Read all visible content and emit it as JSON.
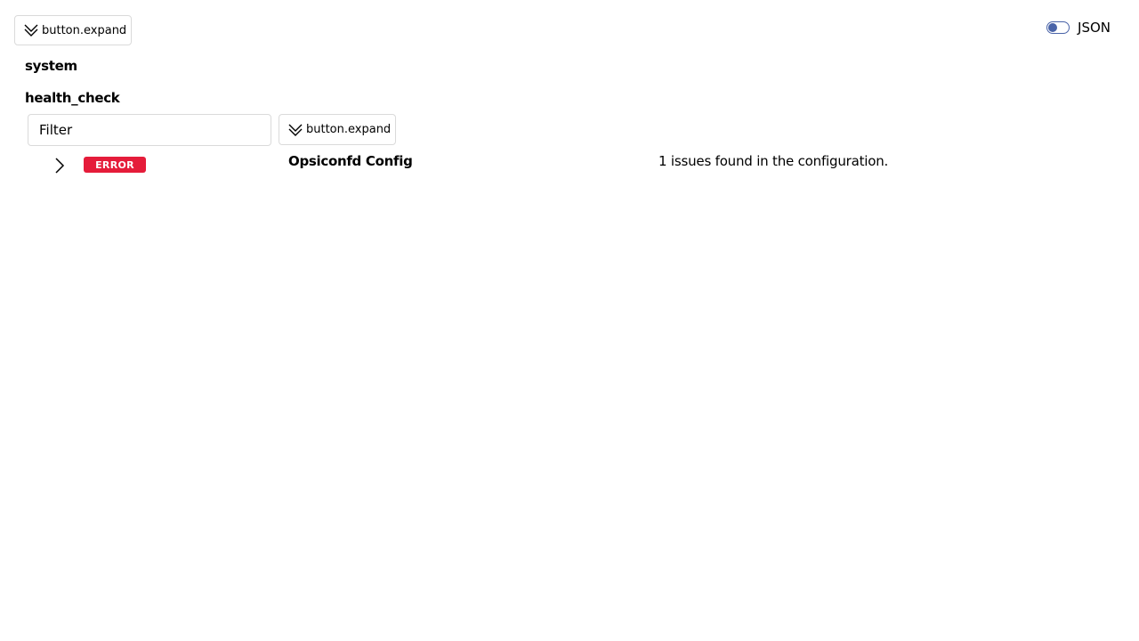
{
  "toolbar": {
    "expand_label": "button.expand",
    "json_toggle_label": "JSON"
  },
  "sections": {
    "system_label": "system",
    "health_check_label": "health_check"
  },
  "filter": {
    "placeholder": "Filter",
    "expand_label": "button.expand"
  },
  "results": [
    {
      "status": "ERROR",
      "title": "Opsiconfd Config",
      "message": "1 issues found in the configuration."
    }
  ],
  "colors": {
    "error_badge": "#e51c3a",
    "toggle_accent": "#4a64a8",
    "border": "#dadada"
  },
  "icons": {
    "expand": "double-chevron-down-icon",
    "row_expand": "chevron-right-icon"
  }
}
